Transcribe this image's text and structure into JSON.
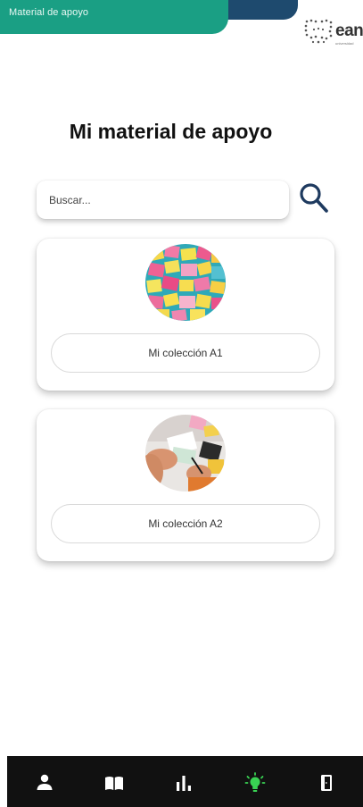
{
  "header": {
    "title": "Material de apoyo"
  },
  "logo": {
    "text": "ean",
    "subtitle": "universidad"
  },
  "page": {
    "title": "Mi material de apoyo"
  },
  "search": {
    "placeholder": "Buscar..."
  },
  "collections": [
    {
      "label": "Mi colección A1",
      "image": "sticky-notes-photo"
    },
    {
      "label": "Mi colección A2",
      "image": "hands-writing-photo"
    }
  ],
  "nav": {
    "items": [
      {
        "icon": "person-icon",
        "active": false
      },
      {
        "icon": "book-icon",
        "active": false
      },
      {
        "icon": "bar-chart-icon",
        "active": false
      },
      {
        "icon": "lightbulb-icon",
        "active": true
      },
      {
        "icon": "door-exit-icon",
        "active": false
      }
    ],
    "colors": {
      "background": "#111111",
      "icon": "#ffffff",
      "active": "#39d353"
    }
  },
  "colors": {
    "banner": "#1a9f84",
    "banner_dark": "#1e4a6e",
    "search_icon": "#1e3a5f"
  }
}
